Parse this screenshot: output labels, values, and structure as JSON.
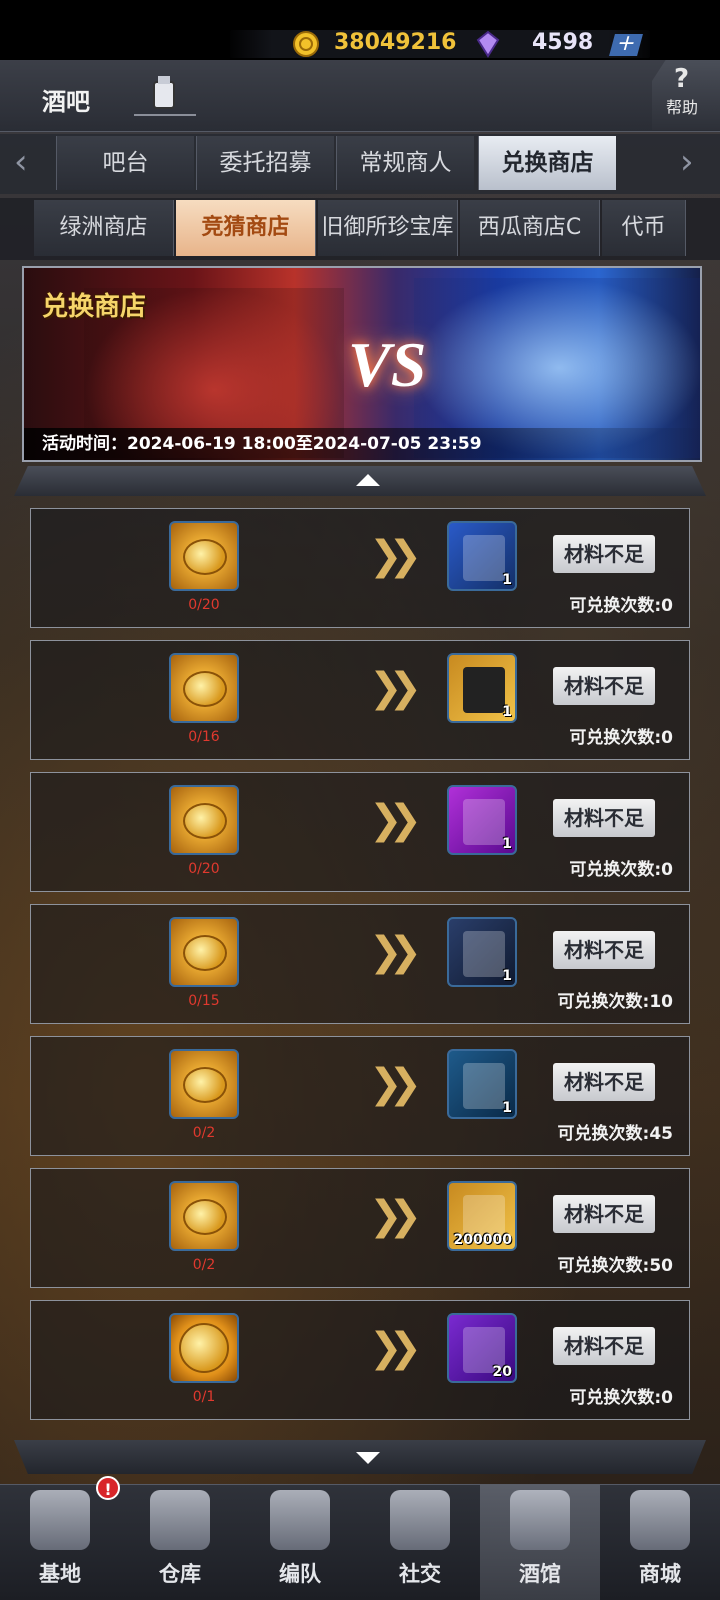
{
  "header": {
    "title": "酒吧",
    "gold": "38049216",
    "gems": "4598",
    "plus": "+",
    "help_label": "帮助",
    "help_symbol": "?"
  },
  "tabs": [
    {
      "label": "吧台"
    },
    {
      "label": "委托招募"
    },
    {
      "label": "常规商人"
    },
    {
      "label": "兑换商店",
      "active": true
    }
  ],
  "subtabs": [
    {
      "label": "绿洲商店"
    },
    {
      "label": "竞猜商店",
      "active": true
    },
    {
      "label": "旧御所珍宝库"
    },
    {
      "label": "西瓜商店C"
    },
    {
      "label": "代币"
    }
  ],
  "banner": {
    "title": "兑换商店",
    "vs": "VS",
    "time": "活动时间：2024-06-19 18:00至2024-07-05 23:59"
  },
  "rows": [
    {
      "cost": "0/20",
      "reward_icon": "card-pack-icon",
      "reward_qty": "1",
      "button": "材料不足",
      "limit": "可兑换次数:0"
    },
    {
      "cost": "0/16",
      "reward_icon": "silhouette-card-icon",
      "reward_qty": "1",
      "button": "材料不足",
      "limit": "可兑换次数:0"
    },
    {
      "cost": "0/20",
      "reward_icon": "purple-puzzle-icon",
      "reward_qty": "1",
      "button": "材料不足",
      "limit": "可兑换次数:0"
    },
    {
      "cost": "0/15",
      "reward_icon": "target-card-icon",
      "reward_qty": "1",
      "button": "材料不足",
      "limit": "可兑换次数:10"
    },
    {
      "cost": "0/2",
      "reward_icon": "syringe-icon",
      "reward_qty": "1",
      "button": "材料不足",
      "limit": "可兑换次数:45"
    },
    {
      "cost": "0/2",
      "reward_icon": "gold-coins-icon",
      "reward_qty": "200000",
      "button": "材料不足",
      "limit": "可兑换次数:50"
    },
    {
      "cost": "0/1",
      "reward_icon": "diamonds-icon",
      "reward_qty": "20",
      "button": "材料不足",
      "limit": "可兑换次数:0"
    }
  ],
  "nav": [
    {
      "label": "基地",
      "badge": "!"
    },
    {
      "label": "仓库"
    },
    {
      "label": "编队"
    },
    {
      "label": "社交"
    },
    {
      "label": "酒馆",
      "active": true
    },
    {
      "label": "商城"
    }
  ],
  "colors": {
    "gold": "#f0c23a",
    "cost_red": "#e0392e",
    "active_subtab": "#e8b48a"
  }
}
